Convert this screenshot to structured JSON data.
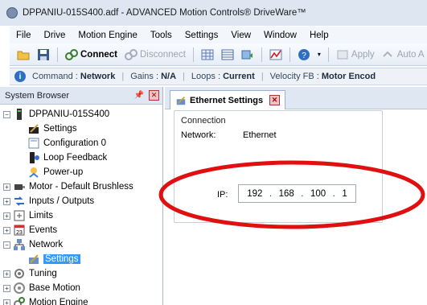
{
  "window": {
    "title": "DPPANIU-015S400.adf - ADVANCED Motion Controls® DriveWare™"
  },
  "menu": [
    "File",
    "Drive",
    "Motion Engine",
    "Tools",
    "Settings",
    "View",
    "Window",
    "Help"
  ],
  "toolbar": {
    "connect_label": "Connect",
    "disconnect_label": "Disconnect",
    "apply_label": "Apply",
    "auto_label": "Auto A"
  },
  "statusbar": {
    "command_label": "Command :",
    "command_value": "Network",
    "gains_label": "Gains :",
    "gains_value": "N/A",
    "loops_label": "Loops :",
    "loops_value": "Current",
    "velocity_label": "Velocity FB :",
    "velocity_value": "Motor Encod"
  },
  "system_browser": {
    "title": "System Browser",
    "items": [
      {
        "label": "DPPANIU-015S400",
        "icon": "drive-icon"
      },
      {
        "label": "Settings",
        "icon": "settings-icon"
      },
      {
        "label": "Configuration 0",
        "icon": "configuration-icon"
      },
      {
        "label": "Loop Feedback",
        "icon": "loop-feedback-icon"
      },
      {
        "label": "Power-up",
        "icon": "power-up-icon"
      },
      {
        "label": "Motor - Default Brushless",
        "icon": "motor-icon"
      },
      {
        "label": "Inputs / Outputs",
        "icon": "io-icon"
      },
      {
        "label": "Limits",
        "icon": "limits-icon"
      },
      {
        "label": "Events",
        "icon": "events-icon"
      },
      {
        "label": "Network",
        "icon": "network-icon"
      },
      {
        "label": "Settings",
        "icon": "network-settings-icon"
      },
      {
        "label": "Tuning",
        "icon": "tuning-icon"
      },
      {
        "label": "Base Motion",
        "icon": "base-motion-icon"
      },
      {
        "label": "Motion Engine",
        "icon": "motion-engine-icon"
      }
    ],
    "selected": "Settings"
  },
  "tab": {
    "label": "Ethernet Settings"
  },
  "ethernet": {
    "group_title": "Connection",
    "network_label": "Network:",
    "network_value": "Ethernet",
    "ip_label": "IP:",
    "ip_octets": [
      "192",
      "168",
      "100",
      "1"
    ]
  },
  "colors": {
    "highlight_oval": "#e01010",
    "selection": "#3399ff",
    "accent": "#2f6fc2"
  }
}
